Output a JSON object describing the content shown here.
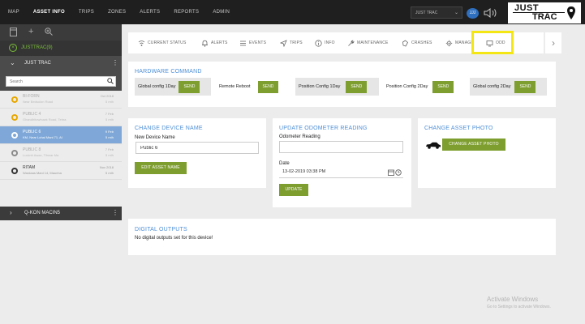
{
  "topnav": {
    "items": [
      "MAP",
      "ASSET INFO",
      "TRIPS",
      "ZONES",
      "ALERTS",
      "REPORTS",
      "ADMIN"
    ],
    "active": "ASSET INFO"
  },
  "header": {
    "account_select": "JUST TRAC",
    "avatar_initials": "JJJ",
    "logo_line1": "JUST",
    "logo_line2": "TRAC"
  },
  "sidebar": {
    "parent_account": "JUSTTRAC(9)",
    "group_name": "JUST TRAC",
    "search_placeholder": "Search",
    "vehicles": [
      {
        "name": "BI-FORN",
        "address": "Near Bedsolon Road",
        "date": "Oct 2018",
        "ago": "5 mth",
        "status": "amber"
      },
      {
        "name": "PUBLIC 4",
        "address": "Ghandhitowhuwk Road, Tehra",
        "date": "7 Feb",
        "ago": "5 mth",
        "status": "amber"
      },
      {
        "name": "PUBLIC 6",
        "address": "KM, Near Lohal Mani 71, Al",
        "date": "9 Feb",
        "ago": "5 mth",
        "status": "selected"
      },
      {
        "name": "PUBLIC 8",
        "address": "Lucknh Awaz, Tihwar Ma",
        "date": "7 Feb",
        "ago": "5 mth",
        "status": "grey"
      },
      {
        "name": "RITAM",
        "address": "Wardaas Mani 14, Maunha",
        "date": "Nov 2018",
        "ago": "5 mth",
        "status": "dark"
      }
    ],
    "group2_name": "Q-KON MACIN5"
  },
  "tabs": [
    {
      "label": "CURRENT STATUS",
      "icon": "wifi-icon"
    },
    {
      "label": "ALERTS",
      "icon": "bell-icon"
    },
    {
      "label": "EVENTS",
      "icon": "list-icon"
    },
    {
      "label": "TRIPS",
      "icon": "navigation-icon"
    },
    {
      "label": "INFO",
      "icon": "info-icon"
    },
    {
      "label": "MAINTENANCE",
      "icon": "wrench-icon"
    },
    {
      "label": "CRASHES",
      "icon": "crash-icon"
    },
    {
      "label": "MANAGE",
      "icon": "gear-icon"
    },
    {
      "label": "ODD",
      "icon": "monitor-icon"
    }
  ],
  "hardware": {
    "title": "HARDWARE COMMAND",
    "send_label": "SEND",
    "commands": [
      "Global config 1Day",
      "Remote Reboot",
      "Position Config 1Day",
      "Position Config 2Day",
      "Global config 2Day"
    ]
  },
  "device_name": {
    "title": "CHANGE DEVICE NAME",
    "field_label": "New Device Name",
    "value": "Public 6",
    "button": "EDIT ASSET NAME"
  },
  "odometer": {
    "title": "UPDATE ODOMETER READING",
    "reading_label": "Odometer Reading",
    "reading_value": "",
    "date_label": "Date",
    "date_value": "13-02-2019 03:38 PM",
    "button": "UPDATE"
  },
  "asset_photo": {
    "title": "CHANGE ASSET PHOTO",
    "button": "CHANGE ASSET PHOTO"
  },
  "digital_outputs": {
    "title": "DIGITAL OUTPUTS",
    "message": "No digital outputs set for this device!"
  },
  "watermark": {
    "line1": "Activate Windows",
    "line2": "Go to Settings to activate Windows."
  },
  "colors": {
    "accent_green": "#7e9e2f",
    "title_blue": "#4e8fd6",
    "highlight_yellow": "#f3e614",
    "selected_row": "#7fa8d8"
  }
}
